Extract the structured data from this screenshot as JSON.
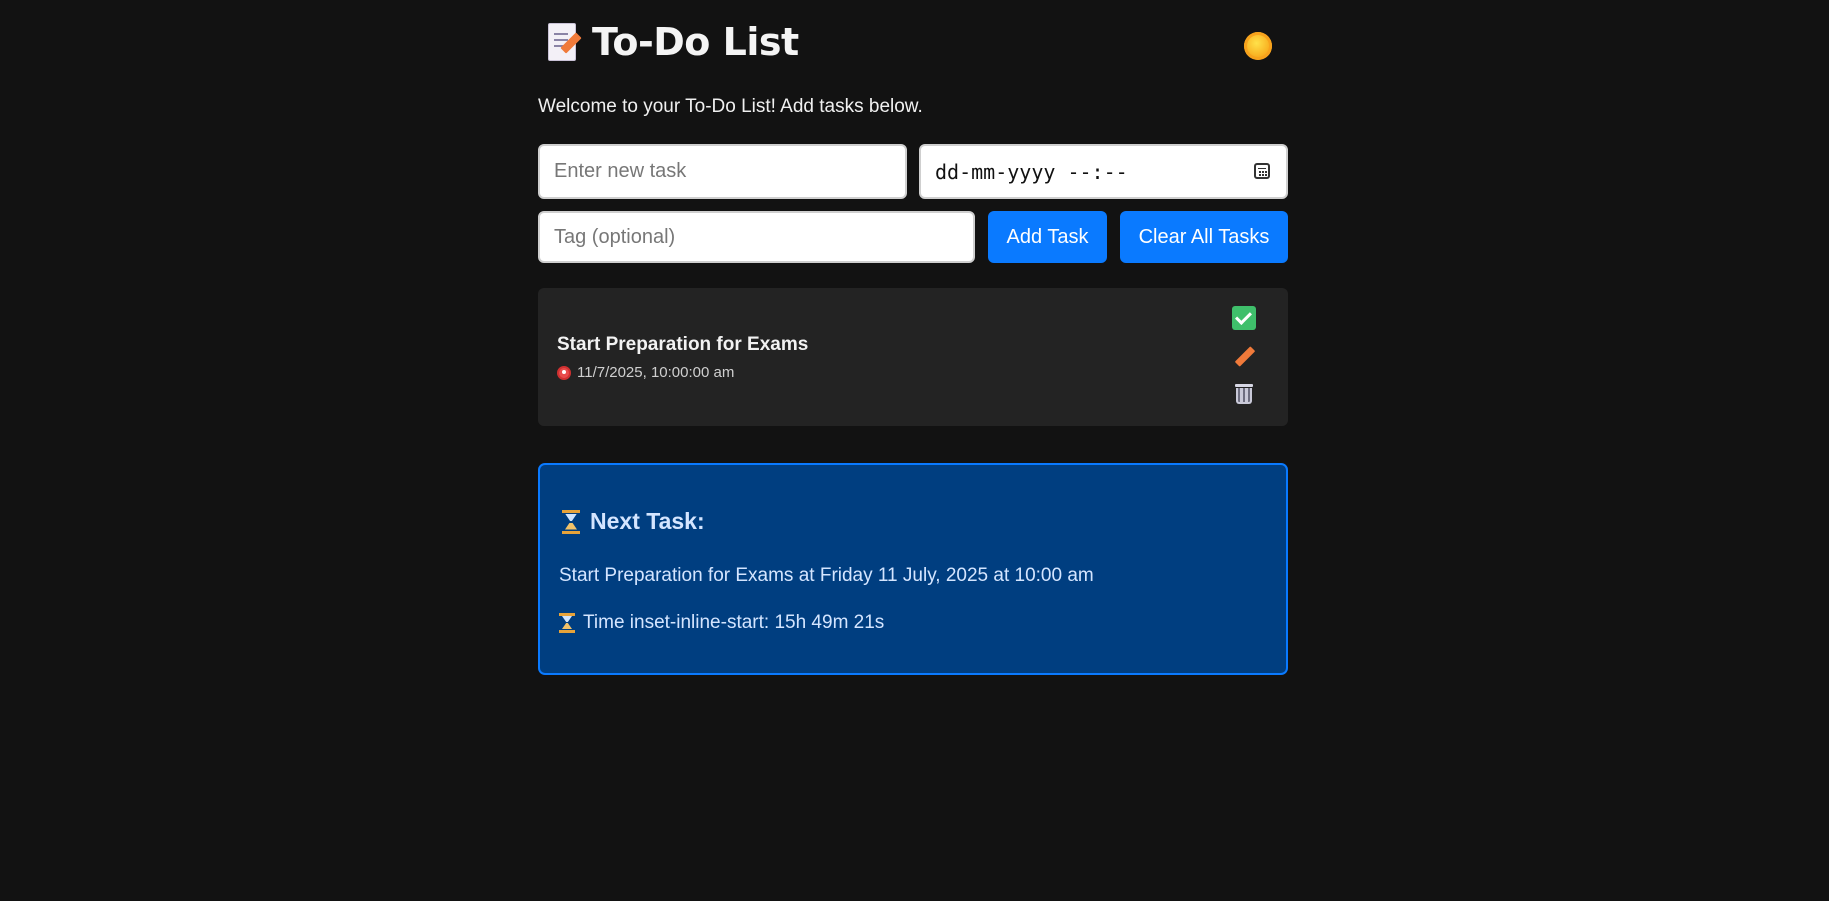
{
  "header": {
    "title": "To-Do List",
    "title_icon": "memo-pencil-icon",
    "theme_toggle_icon": "sun-icon"
  },
  "welcome_text": "Welcome to your To-Do List! Add tasks below.",
  "form": {
    "task_placeholder": "Enter new task",
    "task_value": "",
    "datetime_placeholder": "dd-mm-yyyy --:--",
    "tag_placeholder": "Tag (optional)",
    "add_label": "Add Task",
    "clear_label": "Clear All Tasks"
  },
  "tasks": [
    {
      "title": "Start Preparation for Exams",
      "due": "11/7/2025, 10:00:00 am",
      "icons": [
        "alarm-clock-icon",
        "check-icon",
        "pencil-icon",
        "trash-icon"
      ]
    }
  ],
  "next_task": {
    "heading": "Next Task:",
    "description": "Start Preparation for Exams at Friday 11 July, 2025 at 10:00 am",
    "countdown": "Time inset-inline-start: 15h 49m 21s"
  },
  "colors": {
    "background": "#121212",
    "accent": "#0a7aff",
    "card": "#232323",
    "panel": "#003e80"
  }
}
